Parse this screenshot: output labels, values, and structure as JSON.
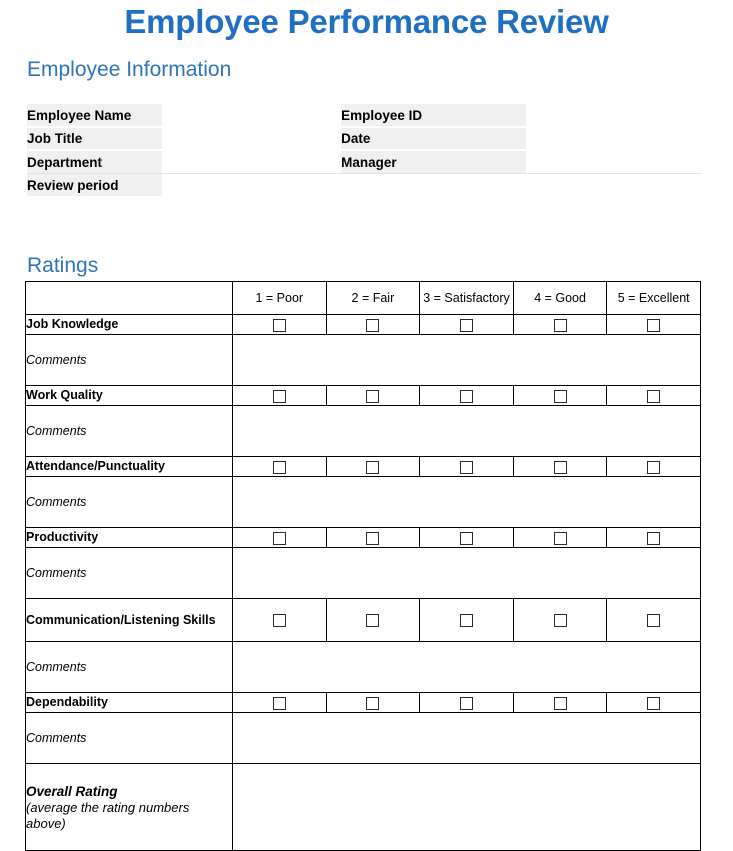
{
  "document": {
    "title": "Employee Performance Review"
  },
  "employee_information": {
    "heading": "Employee Information",
    "rows": [
      {
        "left_label": "Employee Name",
        "left_value": "",
        "right_label": "Employee ID",
        "right_value": ""
      },
      {
        "left_label": "Job Title",
        "left_value": "",
        "right_label": "Date",
        "right_value": ""
      },
      {
        "left_label": "Department",
        "left_value": "",
        "right_label": "Manager",
        "right_value": ""
      },
      {
        "left_label": "Review period",
        "left_value": "",
        "right_label": "",
        "right_value": ""
      }
    ]
  },
  "ratings": {
    "heading": "Ratings",
    "scale": [
      "1 = Poor",
      "2 = Fair",
      "3 = Satisfactory",
      "4 = Good",
      "5 = Excellent"
    ],
    "comments_label": "Comments",
    "criteria": [
      {
        "name": "Job Knowledge",
        "comment": ""
      },
      {
        "name": "Work Quality",
        "comment": ""
      },
      {
        "name": "Attendance/Punctuality",
        "comment": ""
      },
      {
        "name": "Productivity",
        "comment": ""
      },
      {
        "name": "Communication/Listening Skills",
        "comment": ""
      },
      {
        "name": "Dependability",
        "comment": ""
      }
    ],
    "overall": {
      "title": "Overall Rating",
      "note": "(average the rating numbers above)",
      "value": ""
    }
  },
  "colors": {
    "title_blue": "#1F6FC4",
    "heading_blue": "#2E75B6",
    "label_cell_bg": "#F0F0F0",
    "table_border": "#000000"
  }
}
